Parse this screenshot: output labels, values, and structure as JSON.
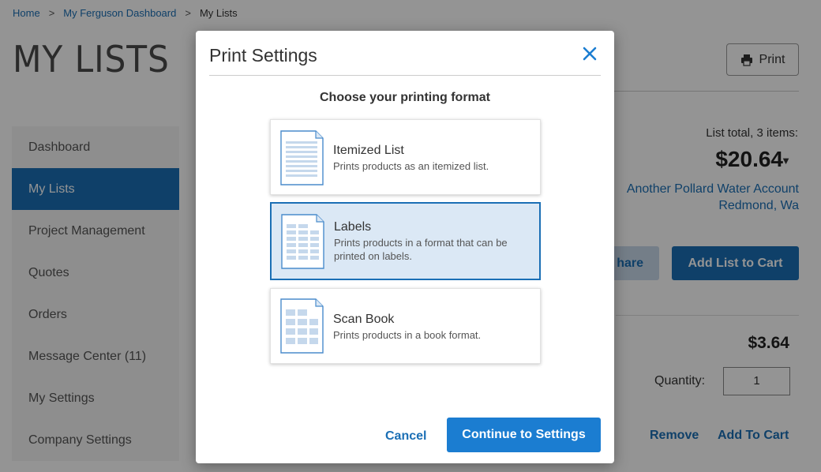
{
  "breadcrumb": {
    "home": "Home",
    "sep1": ">",
    "dashboard": "My Ferguson Dashboard",
    "sep2": ">",
    "current": "My Lists"
  },
  "page": {
    "title": "MY LISTS",
    "print_label": "Print"
  },
  "sidebar": {
    "items": [
      {
        "label": "Dashboard"
      },
      {
        "label": "My Lists"
      },
      {
        "label": "Project Management"
      },
      {
        "label": "Quotes"
      },
      {
        "label": "Orders"
      },
      {
        "label": "Message Center (11)"
      },
      {
        "label": "My Settings"
      },
      {
        "label": "Company Settings"
      }
    ],
    "active_index": 1
  },
  "summary": {
    "label": "List total, 3 items:",
    "total": "$20.64",
    "account_line1": "Another Pollard Water Account",
    "account_line2": "Redmond, Wa",
    "share_label": "hare",
    "add_list_label": "Add List to Cart"
  },
  "item": {
    "price": "$3.64",
    "quantity_label": "Quantity:",
    "quantity_value": "1",
    "remove_label": "Remove",
    "add_to_cart_label": "Add To Cart"
  },
  "modal": {
    "title": "Print Settings",
    "subtitle": "Choose your printing format",
    "options": [
      {
        "name": "Itemized List",
        "desc1": "Prints products as an itemized list.",
        "desc2": "",
        "icon": "itemized-list-doc-icon"
      },
      {
        "name": "Labels",
        "desc1": "Prints products in a format that can be",
        "desc2": "printed on labels.",
        "icon": "labels-doc-icon"
      },
      {
        "name": "Scan Book",
        "desc1": "Prints products in a book format.",
        "desc2": "",
        "icon": "scan-book-doc-icon"
      }
    ],
    "selected_index": 1,
    "cancel_label": "Cancel",
    "continue_label": "Continue to Settings"
  },
  "colors": {
    "accent": "#1b6fb5",
    "button": "#1b7dd1",
    "selected_bg": "#dbe8f5"
  }
}
